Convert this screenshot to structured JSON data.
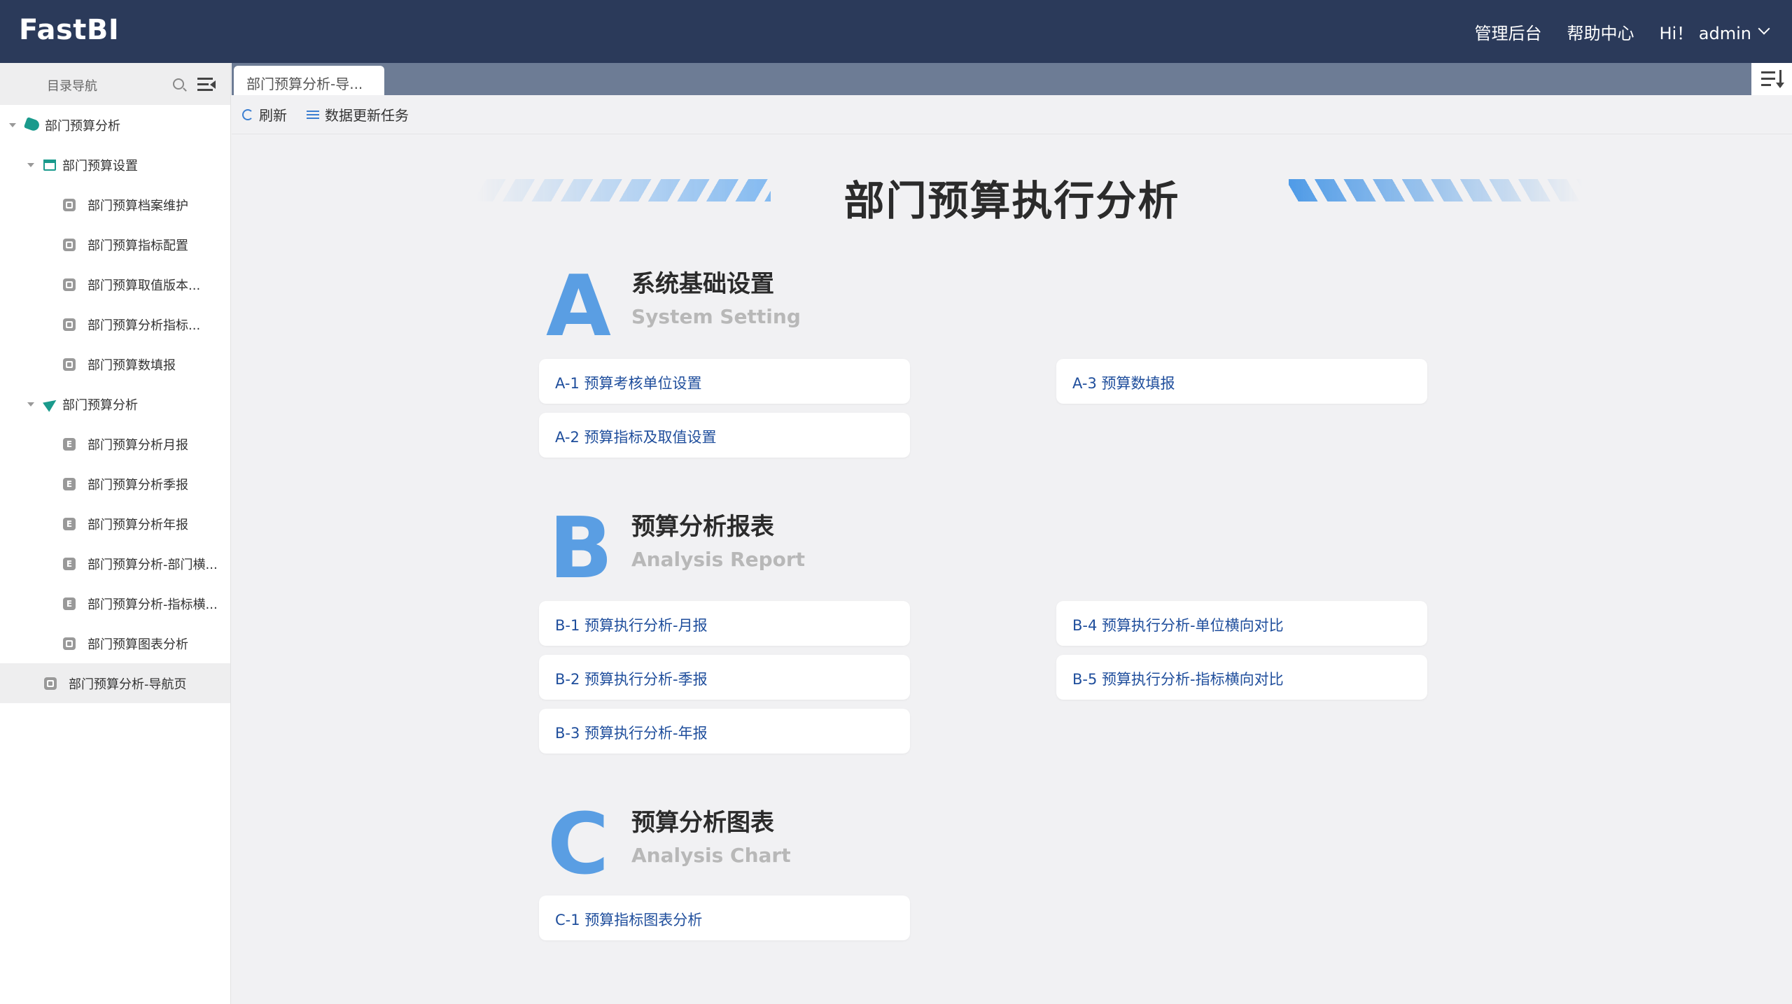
{
  "header": {
    "logo": "FastBI",
    "nav": [
      "管理后台",
      "帮助中心"
    ],
    "user_label": "Hi！ admin"
  },
  "sidebar": {
    "title": "目录导航",
    "items": [
      {
        "label": "部门预算分析",
        "icon": "tag-icon"
      },
      {
        "label": "部门预算设置",
        "icon": "calendar-icon"
      },
      {
        "label": "部门预算档案维护",
        "icon": "report-icon"
      },
      {
        "label": "部门预算指标配置",
        "icon": "report-icon"
      },
      {
        "label": "部门预算取值版本...",
        "icon": "report-icon"
      },
      {
        "label": "部门预算分析指标...",
        "icon": "report-icon"
      },
      {
        "label": "部门预算数填报",
        "icon": "report-icon"
      },
      {
        "label": "部门预算分析",
        "icon": "plane-icon"
      },
      {
        "label": "部门预算分析月报",
        "icon": "excel-icon"
      },
      {
        "label": "部门预算分析季报",
        "icon": "excel-icon"
      },
      {
        "label": "部门预算分析年报",
        "icon": "excel-icon"
      },
      {
        "label": "部门预算分析-部门横...",
        "icon": "excel-icon"
      },
      {
        "label": "部门预算分析-指标横...",
        "icon": "excel-icon"
      },
      {
        "label": "部门预算图表分析",
        "icon": "report-icon"
      },
      {
        "label": "部门预算分析-导航页",
        "icon": "report-icon"
      }
    ]
  },
  "tabs": [
    {
      "label": "部门预算分析-导..."
    }
  ],
  "toolbar": {
    "refresh": "刷新",
    "data_update": "数据更新任务"
  },
  "main": {
    "title": "部门预算执行分析",
    "sections": [
      {
        "letter": "A",
        "title": "系统基础设置",
        "subtitle": "System Setting",
        "links": [
          "A-1 预算考核单位设置",
          "A-2 预算指标及取值设置",
          "A-3 预算数填报"
        ]
      },
      {
        "letter": "B",
        "title": "预算分析报表",
        "subtitle": "Analysis Report",
        "links": [
          "B-1 预算执行分析-月报",
          "B-2 预算执行分析-季报",
          "B-3 预算执行分析-年报",
          "B-4 预算执行分析-单位横向对比",
          "B-5 预算执行分析-指标横向对比"
        ]
      },
      {
        "letter": "C",
        "title": "预算分析图表",
        "subtitle": "Analysis Chart",
        "links": [
          "C-1 预算指标图表分析"
        ]
      }
    ]
  },
  "colors": {
    "header_bg": "#2b3a5a",
    "accent": "#5a9ee3",
    "link": "#1f4e9c",
    "tree_icon": "#1a9a8c"
  }
}
